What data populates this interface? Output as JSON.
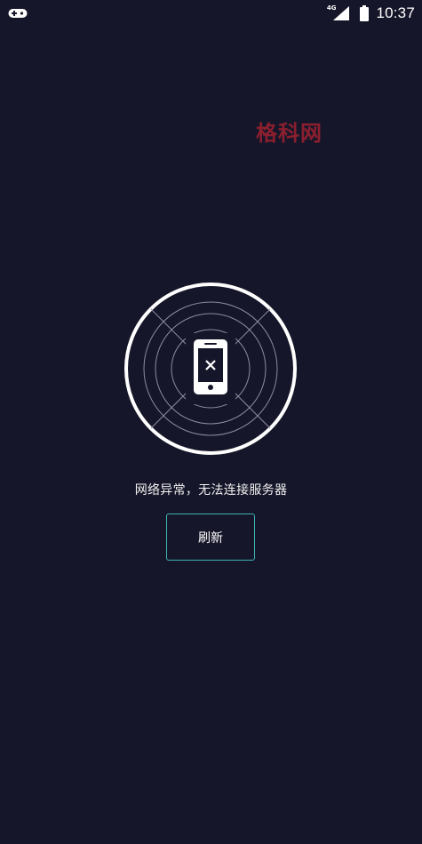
{
  "status_bar": {
    "network_type": "4G",
    "time": "10:37",
    "icons": [
      "game-controller-icon",
      "signal-icon",
      "battery-icon"
    ]
  },
  "watermark": {
    "text": "格科网"
  },
  "main": {
    "illustration_icon": "phone-disconnected-icon",
    "error_message": "网络异常，无法连接服务器",
    "refresh_label": "刷新"
  },
  "colors": {
    "background": "#16162a",
    "button_border": "#3fb3b5",
    "watermark": "#8a1f2e"
  }
}
